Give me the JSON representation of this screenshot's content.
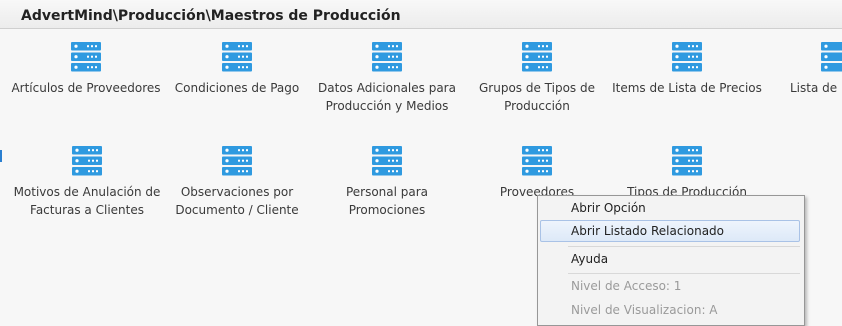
{
  "header": {
    "breadcrumb": "AdvertMind\\Producción\\Maestros de Producción"
  },
  "tiles": [
    {
      "label": "Artículos de Proveedores"
    },
    {
      "label": "Condiciones de Pago"
    },
    {
      "label": "Datos Adicionales para Producción y Medios"
    },
    {
      "label": "Grupos de Tipos de Producción"
    },
    {
      "label": "Items de Lista de Precios"
    },
    {
      "label": "Lista de Precios"
    },
    {
      "label": "Motivos de Anulación de Facturas a Clientes"
    },
    {
      "label": "Observaciones por Documento / Cliente"
    },
    {
      "label": "Personal para Promociones"
    },
    {
      "label": "Proveedores"
    },
    {
      "label": "Tipos de Producción"
    }
  ],
  "tile_icon": "server-stack-icon",
  "colors": {
    "icon": "#2f9ae0",
    "menu_hover": "#dde9f8"
  },
  "context_menu": {
    "items": [
      {
        "label": "Abrir Opción"
      },
      {
        "label": "Abrir Listado Relacionado"
      },
      {
        "label": "Ayuda"
      },
      {
        "label": "Nivel de Acceso: 1"
      },
      {
        "label": "Nivel de Visualizacion: A"
      }
    ]
  }
}
